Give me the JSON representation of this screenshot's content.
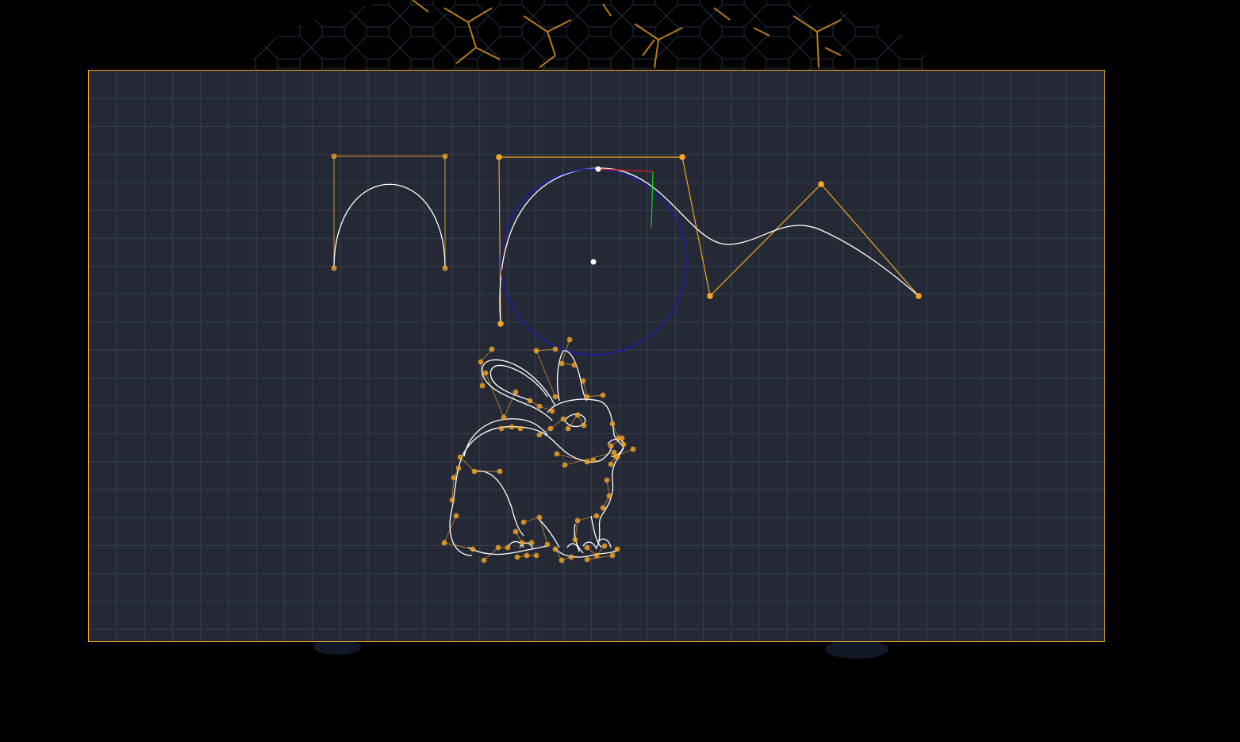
{
  "colors": {
    "page_background": "#000000",
    "canvas_background": "#252936",
    "canvas_border": "#f5a623",
    "grid_line": "#3a3f50",
    "curve_stroke": "#ffffff",
    "control_polygon": "#f5a623",
    "control_point": "#f5a623",
    "circle_guide": "#1a1fa8",
    "axis_x": "#e01919",
    "axis_y": "#19d21a",
    "handle_point": "#ffffff",
    "backdrop_glow": "#f5a623"
  },
  "icons": {
    "control_point": "filled-circle",
    "circle_center": "filled-circle",
    "circle_handle": "filled-circle"
  },
  "scene": {
    "objects": [
      "arch-bezier-curve",
      "circle-curve",
      "wave-bezier-curve",
      "bunny-outline-curve"
    ]
  }
}
